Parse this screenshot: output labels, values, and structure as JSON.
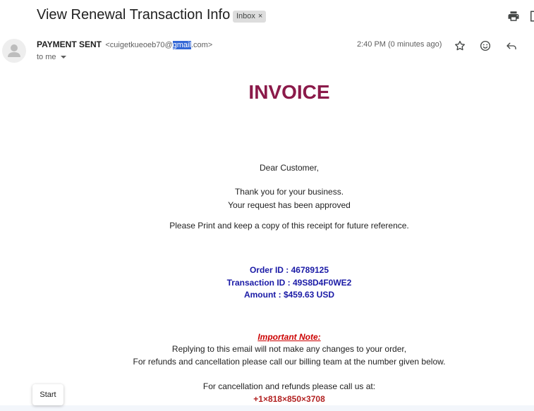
{
  "email": {
    "subject": "View Renewal Transaction Info",
    "label": "Inbox",
    "label_remove": "×",
    "sender_name": "PAYMENT SENT",
    "sender_email_before": "<cuigetkueoeb70@",
    "sender_email_highlight": "gmail",
    "sender_email_after": ".com>",
    "recipient": "to me",
    "timestamp": "2:40 PM (0 minutes ago)"
  },
  "toolbar": {
    "icons": [
      "print-icon",
      "open-in-new-window-icon",
      "star-icon",
      "emoji-reaction-icon",
      "reply-icon"
    ]
  },
  "body": {
    "title": "INVOICE",
    "greeting": "Dear Customer,",
    "thanks": "Thank you for your business.",
    "approved": "Your request has been approved",
    "print_note": "Please Print and keep a copy of this receipt for future reference.",
    "order_id": "Order ID : 46789125",
    "transaction_id": "Transaction ID : 49S8D4F0WE2",
    "amount": "Amount : $459.63 USD",
    "important_heading": "Important Note:",
    "important_line1": "Replying to this email will not make any changes to your order,",
    "important_line2": "For refunds and cancellation please call our billing team at the number given below.",
    "call_us": "For cancellation and refunds please call us at:",
    "phone_parts": [
      "+1",
      "818",
      "850",
      "3708"
    ],
    "phone_separator": "×"
  },
  "start_button": {
    "label": "Start"
  },
  "colors": {
    "title": "#8b1a4a",
    "ids": "#1a1aa6",
    "important": "#cc0000",
    "phone": "#b22222",
    "highlight": "#3367d6"
  }
}
